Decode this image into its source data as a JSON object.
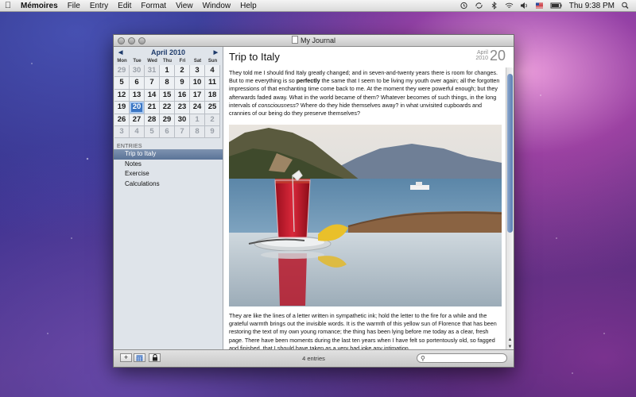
{
  "menubar": {
    "app_name": "Mémoires",
    "items": [
      "File",
      "Entry",
      "Edit",
      "Format",
      "View",
      "Window",
      "Help"
    ],
    "clock": "Thu 9:38 PM"
  },
  "window": {
    "title": "My Journal"
  },
  "calendar": {
    "month_label": "April 2010",
    "weekdays": [
      "Mon",
      "Tue",
      "Wed",
      "Thu",
      "Fri",
      "Sat",
      "Sun"
    ],
    "weeks": [
      [
        "29",
        "30",
        "31",
        "1",
        "2",
        "3",
        "4"
      ],
      [
        "5",
        "6",
        "7",
        "8",
        "9",
        "10",
        "11"
      ],
      [
        "12",
        "13",
        "14",
        "15",
        "16",
        "17",
        "18"
      ],
      [
        "19",
        "20",
        "21",
        "22",
        "23",
        "24",
        "25"
      ],
      [
        "26",
        "27",
        "28",
        "29",
        "30",
        "1",
        "2"
      ],
      [
        "3",
        "4",
        "5",
        "6",
        "7",
        "8",
        "9"
      ]
    ],
    "selected_day": "20"
  },
  "sidebar": {
    "entries_header": "ENTRIES",
    "entries": [
      "Trip to Italy",
      "Notes",
      "Exercise",
      "Calculations"
    ]
  },
  "entry": {
    "title": "Trip to Italy",
    "date_month": "April",
    "date_year": "2010",
    "date_day": "20",
    "paragraph1_parts": [
      "They told me I should find Italy greatly changed; and in seven-and-twenty years there is room for changes.  But to me everything is so ",
      "perfectly",
      " the same that I seem to be living my youth over again; all the forgotten impressions of that enchanting time come back to me.  At the moment they were powerful enough; but they afterwards faded away.  What in the world became of them?  Whatever becomes of such things, in the long intervals of ",
      "consciousness",
      "?  Where do they hide themselves away? in what unvisited cupboards and crannies of our being do they preserve themselves?"
    ],
    "paragraph2": "They are like the lines of a letter written in sympathetic ink; hold the letter to the fire for a while and the grateful warmth brings out the invisible words.  It is the warmth of this yellow sun of Florence that has been restoring the text of my own young romance; the thing has been lying before me today as a clear, fresh page.  There have been moments during the last ten years when I have felt so portentously old, so fagged and finished, that I should have taken as a very bad joke any intimation"
  },
  "bottombar": {
    "entry_count": "4 entries",
    "add_symbol": "+",
    "search_placeholder": ""
  }
}
